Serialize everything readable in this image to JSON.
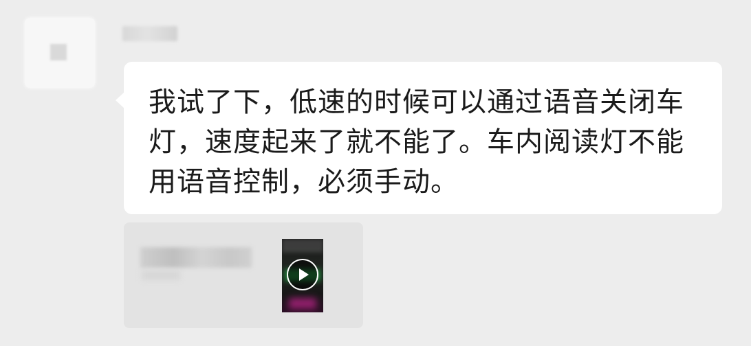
{
  "message": {
    "text": "我试了下，低速的时候可以通过语音关闭车\n灯，速度起来了就不能了。车内阅读灯不能\n用语音控制，必须手动。"
  },
  "quote": {
    "thumbnail_icon": "play-icon"
  },
  "colors": {
    "background": "#ededed",
    "bubble": "#ffffff",
    "text": "#1a1a1a",
    "quote_card": "#e3e3e3"
  }
}
